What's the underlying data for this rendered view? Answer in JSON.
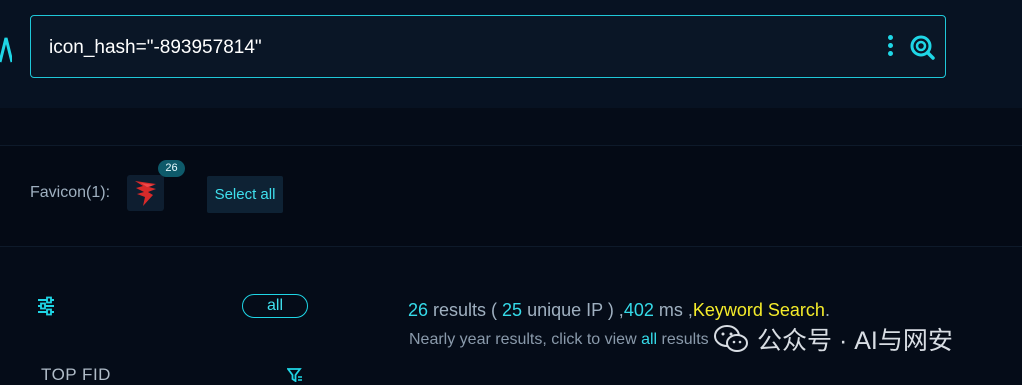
{
  "search": {
    "query": "icon_hash=\"-893957814\"",
    "more_icon": "kebab-icon",
    "search_icon": "search-icon"
  },
  "favicon": {
    "label": "Favicon(1):",
    "count_badge": "26",
    "select_all_label": "Select all"
  },
  "filters": {
    "all_label": "all",
    "section_title": "TOP FID"
  },
  "results": {
    "count": "26",
    "text_results": " results ( ",
    "unique_ip": "25",
    "text_unique_ip": " unique IP ) ,",
    "time_ms": "402",
    "text_ms": " ms ,",
    "keyword_search": "Keyword Search",
    "period": ".",
    "subline_prefix": "Nearly year results, click to view ",
    "subline_link": "all",
    "subline_suffix": " results"
  },
  "watermark": {
    "text": "公众号 · AI与网安"
  },
  "colors": {
    "accent": "#1fd6e6",
    "keyword": "#f5ec2a",
    "background": "#050c18"
  }
}
